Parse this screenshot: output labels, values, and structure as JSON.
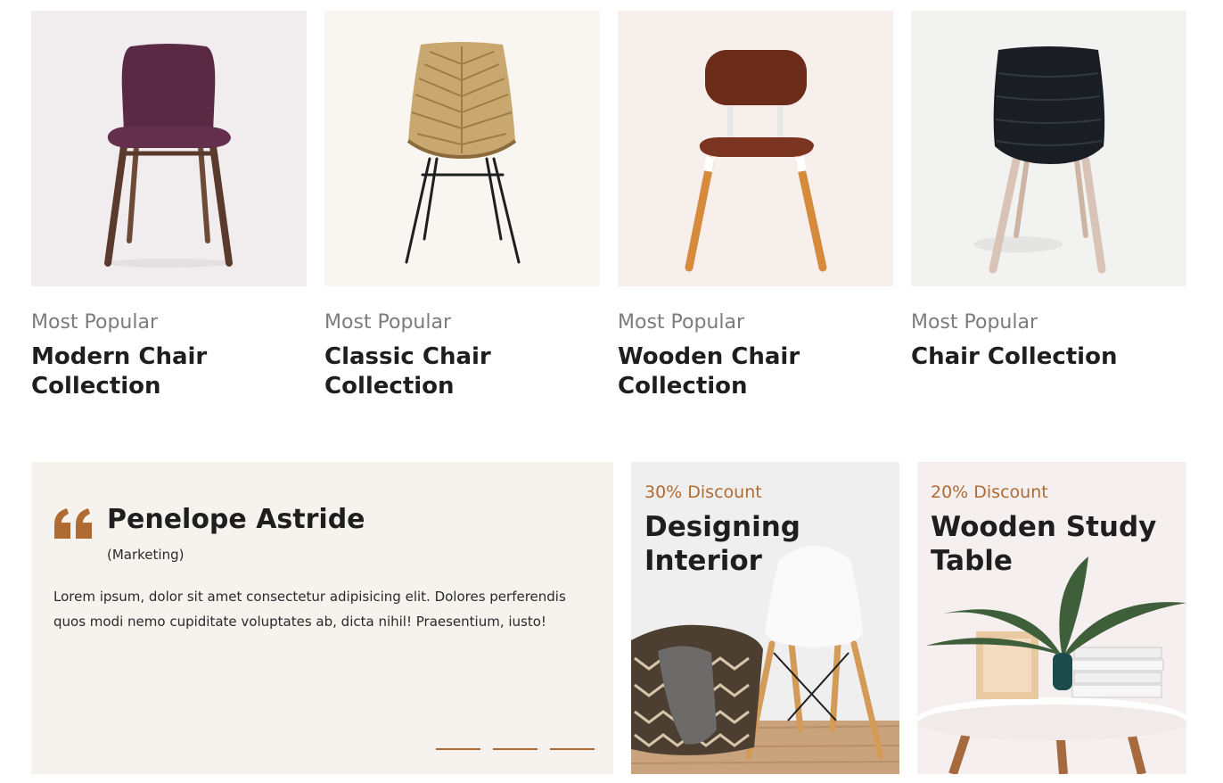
{
  "products": [
    {
      "tag": "Most Popular",
      "title": "Modern Chair Collection",
      "image": "purple-upholstered-chair"
    },
    {
      "tag": "Most Popular",
      "title": "Classic Chair Collection",
      "image": "rattan-chair"
    },
    {
      "tag": "Most Popular",
      "title": "Wooden Chair Collection",
      "image": "leather-wood-chair"
    },
    {
      "tag": "Most Popular",
      "title": "Chair Collection",
      "image": "black-leather-chair"
    }
  ],
  "testimonial": {
    "name": "Penelope Astride",
    "role": "(Marketing)",
    "text": "Lorem ipsum, dolor sit amet consectetur adipisicing elit. Dolores perferendis quos modi nemo cupiditate voluptates ab, dicta nihil! Praesentium, iusto!",
    "slides": 3
  },
  "promos": [
    {
      "discount": "30% Discount",
      "title": "Designing Interior",
      "image": "white-chair-basket"
    },
    {
      "discount": "20% Discount",
      "title": "Wooden Study Table",
      "image": "table-plant-books"
    }
  ],
  "colors": {
    "accent": "#b06b32",
    "testimonial_bg": "#f6f3ef"
  }
}
